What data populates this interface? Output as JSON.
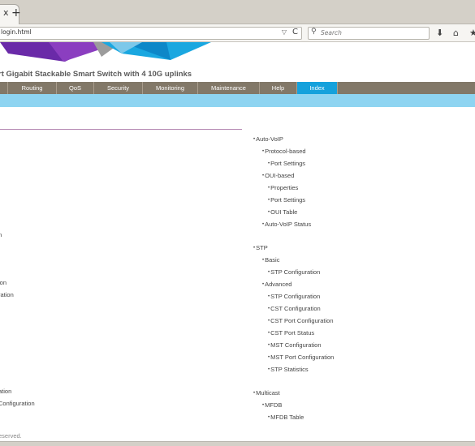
{
  "browser": {
    "tab_close": "x",
    "new_tab": "+",
    "url": "login.html",
    "search_placeholder": "Search",
    "url_dropdown_icon": "▽",
    "reload_icon": "C",
    "search_icon": "⚲",
    "download_icon": "⬇",
    "home_icon": "⌂",
    "bookmark_icon": "★"
  },
  "header": {
    "product_title": "rt Gigabit Stackable Smart Switch with 4 10G uplinks"
  },
  "menu": {
    "items": [
      {
        "label": ""
      },
      {
        "label": "Routing"
      },
      {
        "label": "QoS"
      },
      {
        "label": "Security"
      },
      {
        "label": "Monitoring"
      },
      {
        "label": "Maintenance"
      },
      {
        "label": "Help"
      },
      {
        "label": "Index"
      }
    ]
  },
  "left_fragments": [
    {
      "text": "n"
    },
    {
      "text": "ion"
    },
    {
      "text": "ration"
    },
    {
      "text": "ation"
    },
    {
      "text": "Configuration"
    }
  ],
  "index_tree": [
    {
      "label": "Auto-VoIP"
    },
    {
      "label": "Protocol-based"
    },
    {
      "label": "Port Settings"
    },
    {
      "label": "OUI-based"
    },
    {
      "label": "Properties"
    },
    {
      "label": "Port Settings"
    },
    {
      "label": "OUI Table"
    },
    {
      "label": "Auto-VoIP Status"
    },
    {
      "label": "STP"
    },
    {
      "label": "Basic"
    },
    {
      "label": "STP Configuration"
    },
    {
      "label": "Advanced"
    },
    {
      "label": "STP Configuration"
    },
    {
      "label": "CST Configuration"
    },
    {
      "label": "CST Port Configuration"
    },
    {
      "label": "CST Port Status"
    },
    {
      "label": "MST Configuration"
    },
    {
      "label": "MST Port Configuration"
    },
    {
      "label": "STP Statistics"
    },
    {
      "label": "Multicast"
    },
    {
      "label": "MFDB"
    },
    {
      "label": "MFDB Table"
    }
  ],
  "footer": {
    "text": "eserved."
  },
  "colors": {
    "menu_bg": "#827868",
    "menu_active": "#15a1dc",
    "subbar": "#8ed4f1",
    "rule": "#b68ab4"
  }
}
